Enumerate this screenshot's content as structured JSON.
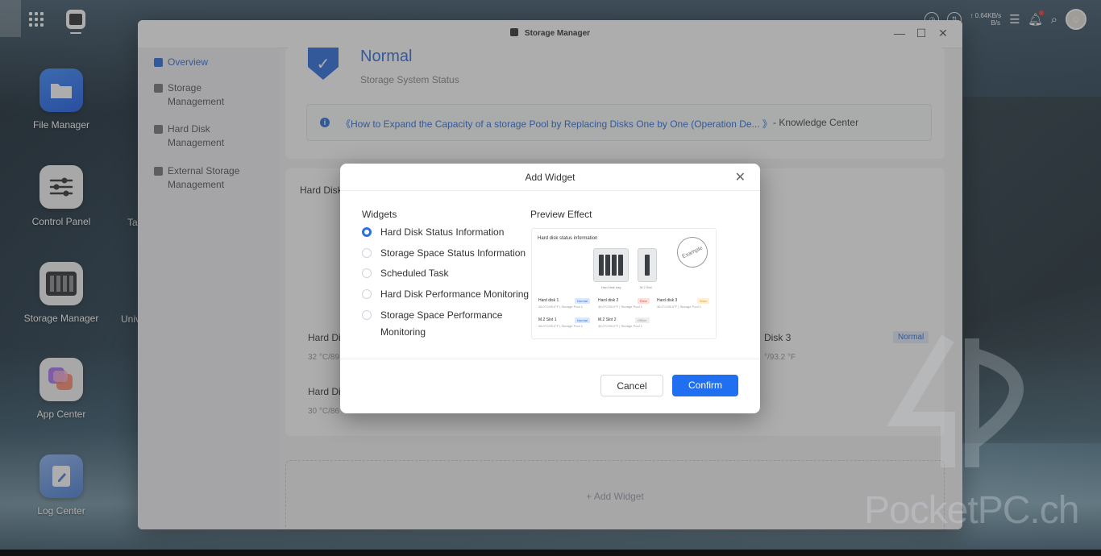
{
  "topbar": {
    "speed_up": "↑ 0.64KB/s",
    "speed_down": "B/s",
    "accent": "#2f6fe0"
  },
  "desktop": {
    "icons": [
      {
        "label": "File Manager",
        "icon": "folder-icon"
      },
      {
        "label": "Control Panel",
        "icon": "sliders-icon"
      },
      {
        "label": "Storage Manager",
        "icon": "storage-icon"
      },
      {
        "label": "App Center",
        "icon": "app-center-icon"
      },
      {
        "label": "Log Center",
        "icon": "log-icon"
      }
    ],
    "partial_labels": [
      "Ta",
      "Univ"
    ]
  },
  "window": {
    "title": "Storage Manager",
    "sidebar": [
      {
        "label": "Overview",
        "icon": "overview-icon"
      },
      {
        "label": "Storage Management",
        "icon": "storage-icon"
      },
      {
        "label": "Hard Disk Management",
        "icon": "disk-icon"
      },
      {
        "label": "External Storage Management",
        "icon": "external-icon"
      }
    ],
    "status": {
      "value": "Normal",
      "caption": "Storage System Status"
    },
    "knowledge": {
      "link": "《How to Expand the Capacity of a storage Pool by Replacing Disks One by One (Operation De... 》",
      "source": "- Knowledge Center"
    },
    "disks": {
      "section_label": "Hard Disk",
      "disk1_name": "Hard Di",
      "disk1_temp": "32 °C/89",
      "disk2_name": "Hard Di",
      "disk2_temp": "30 °C/86",
      "disk3_name": "Disk 3",
      "disk3_temp": "°/93.2 °F",
      "disk3_status": "Normal",
      "disk4_temp": "°"
    },
    "add_widget": "+ Add Widget"
  },
  "modal": {
    "title": "Add Widget",
    "widgets_heading": "Widgets",
    "preview_heading": "Preview Effect",
    "options": [
      {
        "label": "Hard Disk Status Information",
        "selected": true
      },
      {
        "label": "Storage Space Status Information",
        "selected": false
      },
      {
        "label": "Scheduled Task",
        "selected": false
      },
      {
        "label": "Hard Disk Performance Monitoring",
        "selected": false
      },
      {
        "label": "Storage Space Performance Monitoring",
        "selected": false
      }
    ],
    "preview": {
      "title": "Hard disk status information",
      "stamp": "Example",
      "cap1": "Hard disk bay",
      "cap2": "M.2 Slot",
      "cells": [
        {
          "name": "Hard disk 1",
          "sub": "36.0°C/95.0°F | Storage Pool 1",
          "tag": "Normal"
        },
        {
          "name": "Hard disk 2",
          "sub": "36.0°C/95.0°F | Storage Pool 1",
          "tag": "Error"
        },
        {
          "name": "Hard disk 3",
          "sub": "36.0°C/95.0°F | Storage Pool 1",
          "tag": "Warn"
        },
        {
          "name": "M.2 Slot 1",
          "sub": "36.0°C/95.0°F | Storage Pool 1",
          "tag": "Normal"
        },
        {
          "name": "M.2 Slot 2",
          "sub": "36.0°C/95.0°F | Storage Pool 1",
          "tag": "Offline"
        }
      ]
    },
    "cancel": "Cancel",
    "confirm": "Confirm"
  },
  "watermark": "PocketPC.ch"
}
